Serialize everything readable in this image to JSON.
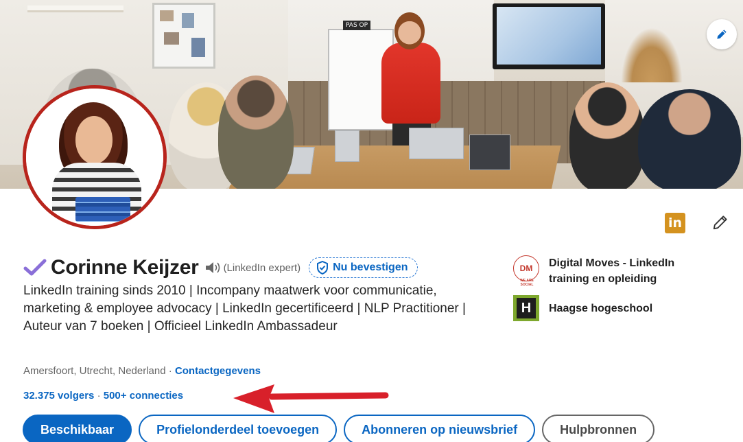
{
  "profile": {
    "name": "Corinne Keijzer",
    "pronunciation_label": "(LinkedIn expert)",
    "verify_label": "Nu bevestigen",
    "headline": "LinkedIn training sinds 2010 | Incompany maatwerk voor communicatie, marketing & employee advocacy | LinkedIn gecertificeerd | NLP Practitioner | Auteur van 7 boeken | Officieel LinkedIn Ambassadeur",
    "location": "Amersfoort, Utrecht, Nederland",
    "location_separator": " · ",
    "contact_link": "Contactgegevens",
    "followers": "32.375 volgers",
    "stats_separator": " · ",
    "connections": "500+ connecties"
  },
  "cover": {
    "sign_text": "PAS OP"
  },
  "companies": [
    {
      "name": "Digital Moves - LinkedIn training en opleiding",
      "logo_text": "DM",
      "logo_subtext": "WE ARE SOCIAL"
    },
    {
      "name": "Haagse hogeschool",
      "logo_text": "H"
    }
  ],
  "badge": {
    "text": "in",
    "color": "#d4921f"
  },
  "buttons": {
    "available": "Beschikbaar",
    "add_section": "Profielonderdeel toevoegen",
    "subscribe": "Abonneren op nieuwsbrief",
    "resources": "Hulpbronnen"
  },
  "colors": {
    "accent": "#0a66c2",
    "avatar_ring": "#b8241c",
    "arrow": "#d8202a",
    "verified_check": "#8a6fd8"
  },
  "icons": [
    "pencil-icon",
    "linkedin-icon",
    "verified-check-icon",
    "speaker-icon",
    "shield-check-icon",
    "red-arrow"
  ]
}
